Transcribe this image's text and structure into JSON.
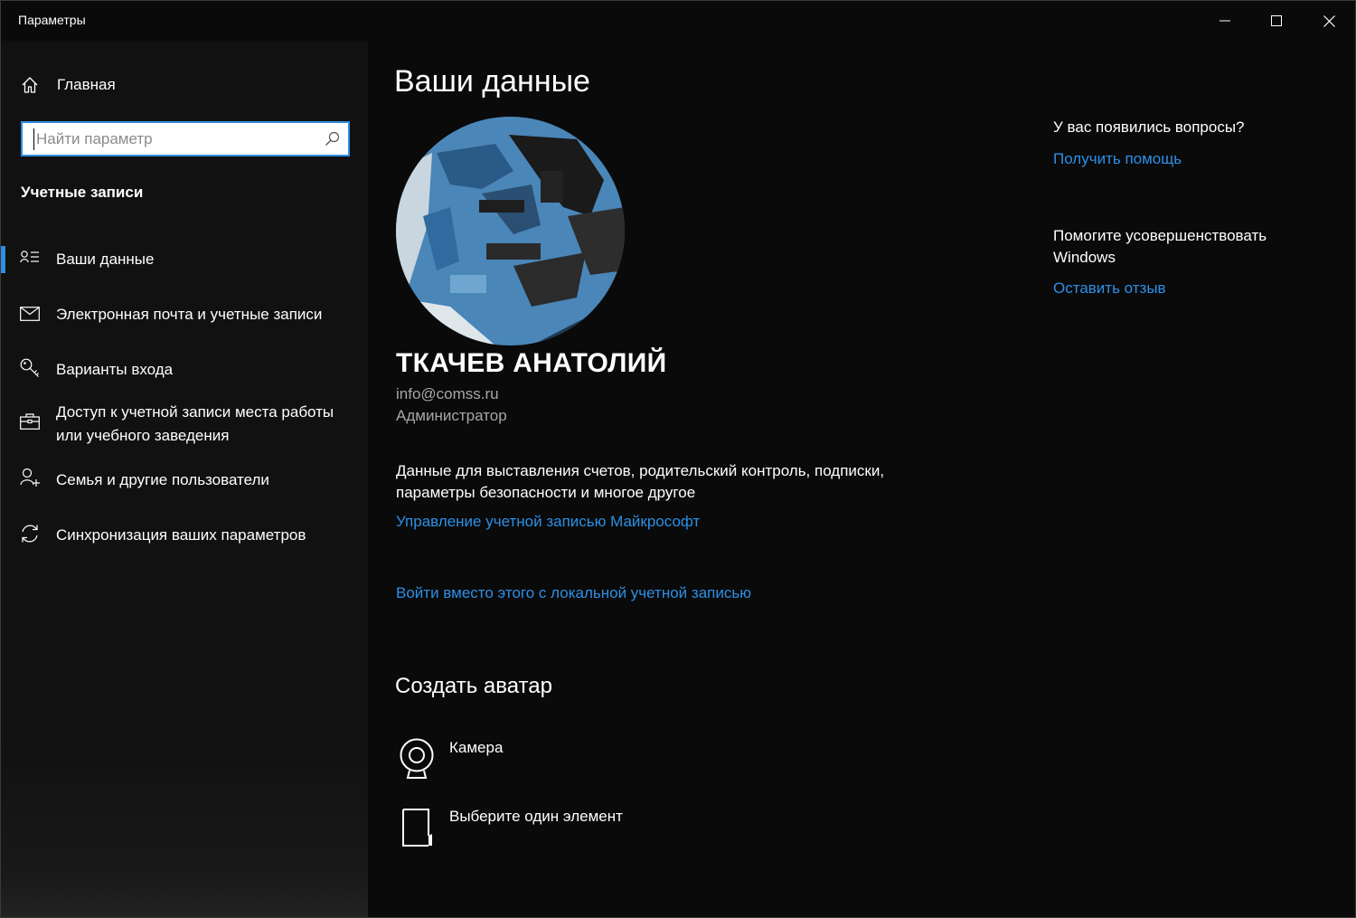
{
  "window": {
    "title": "Параметры",
    "controls": [
      "minimize",
      "maximize",
      "close"
    ]
  },
  "sidebar": {
    "home_label": "Главная",
    "search_placeholder": "Найти параметр",
    "section_title": "Учетные записи",
    "items": [
      {
        "label": "Ваши данные",
        "icon": "person-card-icon",
        "active": true
      },
      {
        "label": "Электронная почта и учетные записи",
        "icon": "mail-icon",
        "active": false
      },
      {
        "label": "Варианты входа",
        "icon": "key-icon",
        "active": false
      },
      {
        "label_line1": "Доступ к учетной записи места работы",
        "label_line2": "или учебного заведения",
        "icon": "briefcase-icon",
        "active": false
      },
      {
        "label": "Семья и другие пользователи",
        "icon": "add-person-icon",
        "active": false
      },
      {
        "label": "Синхронизация ваших параметров",
        "icon": "sync-icon",
        "active": false
      }
    ]
  },
  "main": {
    "title": "Ваши данные",
    "user": {
      "name": "ТКАЧЕВ АНАТОЛИЙ",
      "email": "info@comss.ru",
      "role": "Администратор"
    },
    "description_line1": "Данные для выставления счетов, родительский контроль, подписки,",
    "description_line2": "параметры безопасности и многое другое",
    "manage_link": "Управление учетной записью Майкрософт",
    "local_link": "Войти вместо этого с локальной учетной записью",
    "avatar_section_title": "Создать аватар",
    "avatar_options": [
      {
        "label": "Камера",
        "icon": "webcam-icon"
      },
      {
        "label": "Выберите один элемент",
        "icon": "browse-file-icon"
      }
    ]
  },
  "aside": {
    "help_question": "У вас появились вопросы?",
    "help_link": "Получить помощь",
    "improve_line1": "Помогите усовершенствовать",
    "improve_line2": "Windows",
    "feedback_link": "Оставить отзыв"
  },
  "colors": {
    "background": "#0a0a0a",
    "sidebar": "#111111",
    "accent": "#2f8ee0",
    "link": "#2d8fe6",
    "secondary_text": "#a6a6a6"
  }
}
